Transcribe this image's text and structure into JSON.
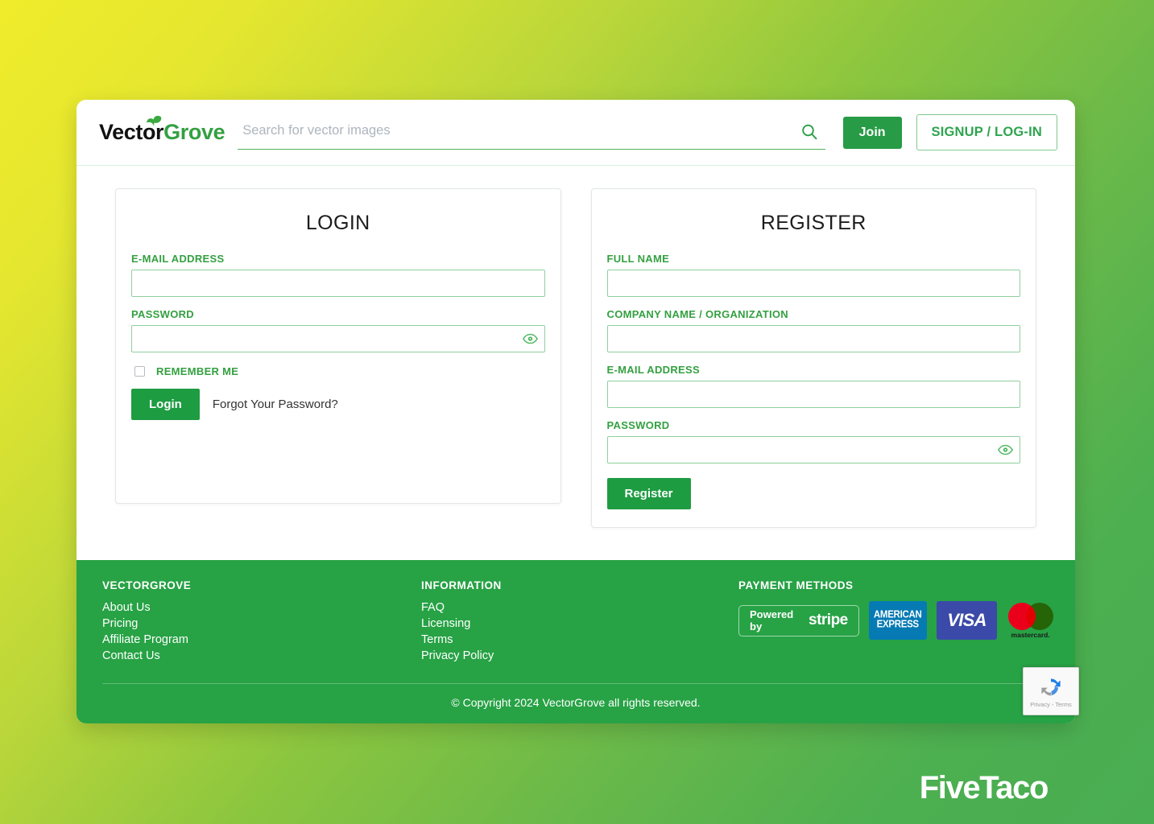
{
  "colors": {
    "brand_green": "#34a041",
    "button_green": "#1e9c42",
    "footer_green": "#27a245",
    "input_border": "#8fcf9d",
    "bg_gradient_start": "#f0ec2b",
    "bg_gradient_end": "#49ad52"
  },
  "header": {
    "logo": {
      "part1": "Vect",
      "part2": "or",
      "part3": "Grove",
      "full": "VectorGrove"
    },
    "search": {
      "value": "",
      "placeholder": "Search for vector images",
      "icon": "search-icon"
    },
    "join_label": "Join",
    "signup_login_label": "SIGNUP / LOG-IN"
  },
  "login_panel": {
    "title": "LOGIN",
    "email": {
      "label": "E-MAIL ADDRESS",
      "value": "",
      "placeholder": ""
    },
    "password": {
      "label": "PASSWORD",
      "value": "",
      "placeholder": "",
      "toggle_icon": "eye-icon"
    },
    "remember_label": "REMEMBER ME",
    "remember_checked": false,
    "submit_label": "Login",
    "forgot_label": "Forgot Your Password?"
  },
  "register_panel": {
    "title": "REGISTER",
    "full_name": {
      "label": "FULL NAME",
      "value": "",
      "placeholder": ""
    },
    "company": {
      "label": "COMPANY NAME / ORGANIZATION",
      "value": "",
      "placeholder": ""
    },
    "email": {
      "label": "E-MAIL ADDRESS",
      "value": "",
      "placeholder": ""
    },
    "password": {
      "label": "PASSWORD",
      "value": "",
      "placeholder": "",
      "toggle_icon": "eye-icon"
    },
    "submit_label": "Register"
  },
  "footer": {
    "brand_column": {
      "title": "VECTORGROVE",
      "links": [
        "About Us",
        "Pricing",
        "Affiliate Program",
        "Contact Us"
      ]
    },
    "info_column": {
      "title": "INFORMATION",
      "links": [
        "FAQ",
        "Licensing",
        "Terms",
        "Privacy Policy"
      ]
    },
    "payment_column": {
      "title": "PAYMENT METHODS",
      "methods": [
        {
          "name": "stripe",
          "powered_by": "Powered by",
          "wordmark": "stripe"
        },
        {
          "name": "american-express",
          "line1": "AMERICAN",
          "line2": "EXPRESS"
        },
        {
          "name": "visa",
          "wordmark": "VISA"
        },
        {
          "name": "mastercard",
          "wordmark": "mastercard."
        }
      ]
    },
    "copyright": "© Copyright 2024 VectorGrove all rights reserved."
  },
  "recaptcha": {
    "text": "Privacy - Terms",
    "icon": "recaptcha-icon"
  },
  "watermark": {
    "text": "FiveTaco"
  }
}
